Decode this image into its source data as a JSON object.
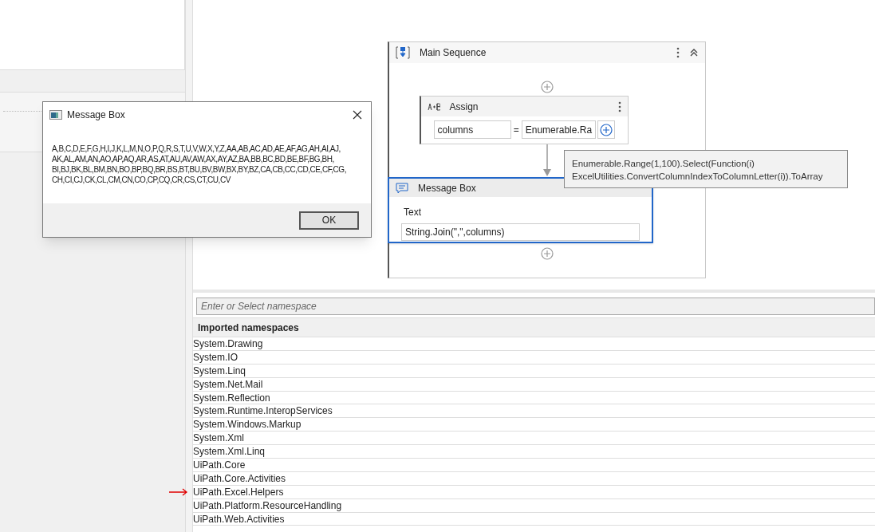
{
  "sequence": {
    "title": "Main Sequence",
    "collapsed": false,
    "assign": {
      "title": "Assign",
      "to": "columns",
      "equals": "=",
      "value": "Enumerable.Ra"
    },
    "message_box": {
      "title": "Message Box",
      "selected": true,
      "field_label": "Text",
      "field_value": "String.Join(\",\",columns)"
    }
  },
  "tooltip": {
    "lines": [
      "Enumerable.Range(1,100).Select(Function(i)",
      "ExcelUtilities.ConvertColumnIndexToColumnLetter(i)).ToArray"
    ]
  },
  "namespaces": {
    "placeholder": "Enter or Select namespace",
    "header": "Imported namespaces",
    "items": [
      {
        "name": "System.Drawing",
        "marked": false
      },
      {
        "name": "System.IO",
        "marked": false
      },
      {
        "name": "System.Linq",
        "marked": false
      },
      {
        "name": "System.Net.Mail",
        "marked": false
      },
      {
        "name": "System.Reflection",
        "marked": false
      },
      {
        "name": "System.Runtime.InteropServices",
        "marked": false
      },
      {
        "name": "System.Windows.Markup",
        "marked": false
      },
      {
        "name": "System.Xml",
        "marked": false
      },
      {
        "name": "System.Xml.Linq",
        "marked": false
      },
      {
        "name": "UiPath.Core",
        "marked": false
      },
      {
        "name": "UiPath.Core.Activities",
        "marked": false
      },
      {
        "name": "UiPath.Excel.Helpers",
        "marked": true
      },
      {
        "name": "UiPath.Platform.ResourceHandling",
        "marked": false
      },
      {
        "name": "UiPath.Web.Activities",
        "marked": false
      }
    ]
  },
  "dialog": {
    "title": "Message Box",
    "lines": [
      "A,B,C,D,E,F,G,H,I,J,K,L,M,N,O,P,Q,R,S,T,U,V,W,X,Y,Z,AA,AB,AC,AD,AE,AF,AG,AH,AI,AJ,",
      "AK,AL,AM,AN,AO,AP,AQ,AR,AS,AT,AU,AV,AW,AX,AY,AZ,BA,BB,BC,BD,BE,BF,BG,BH,",
      "BI,BJ,BK,BL,BM,BN,BO,BP,BQ,BR,BS,BT,BU,BV,BW,BX,BY,BZ,CA,CB,CC,CD,CE,CF,CG,",
      "CH,CI,CJ,CK,CL,CM,CN,CO,CP,CQ,CR,CS,CT,CU,CV"
    ],
    "button": "OK"
  }
}
